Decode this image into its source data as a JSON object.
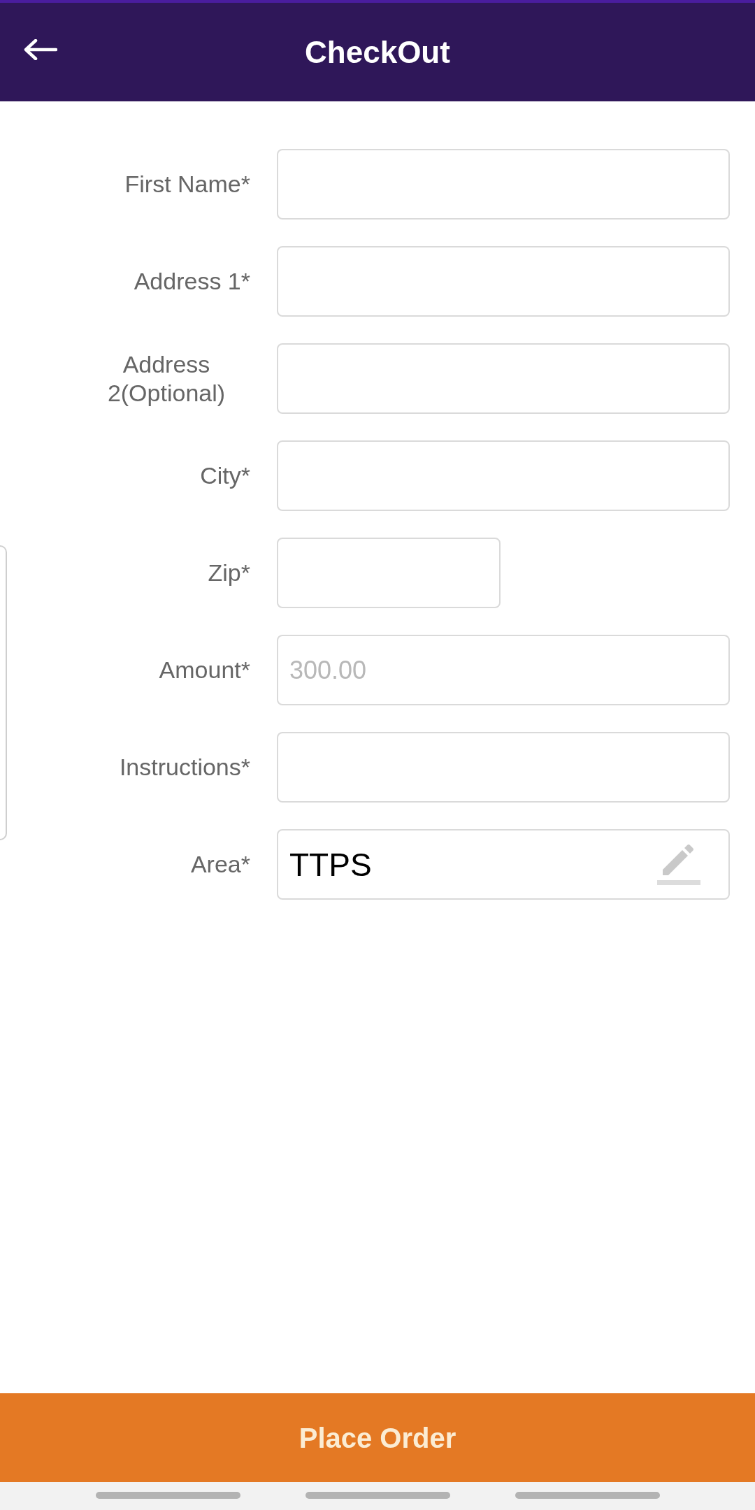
{
  "header": {
    "title": "CheckOut"
  },
  "form": {
    "fields": [
      {
        "label": "First Name*",
        "kind": "text"
      },
      {
        "label": "Address 1*",
        "kind": "text"
      },
      {
        "label": "Address 2(Optional)",
        "kind": "text"
      },
      {
        "label": "City*",
        "kind": "text"
      },
      {
        "label": "Zip*",
        "kind": "short"
      },
      {
        "label": "Amount*",
        "kind": "text",
        "placeholder": "300.00"
      },
      {
        "label": "Instructions*",
        "kind": "text"
      },
      {
        "label": "Area*",
        "kind": "picker",
        "value": "TTPS"
      }
    ]
  },
  "place_order": {
    "label": "Place Order"
  }
}
